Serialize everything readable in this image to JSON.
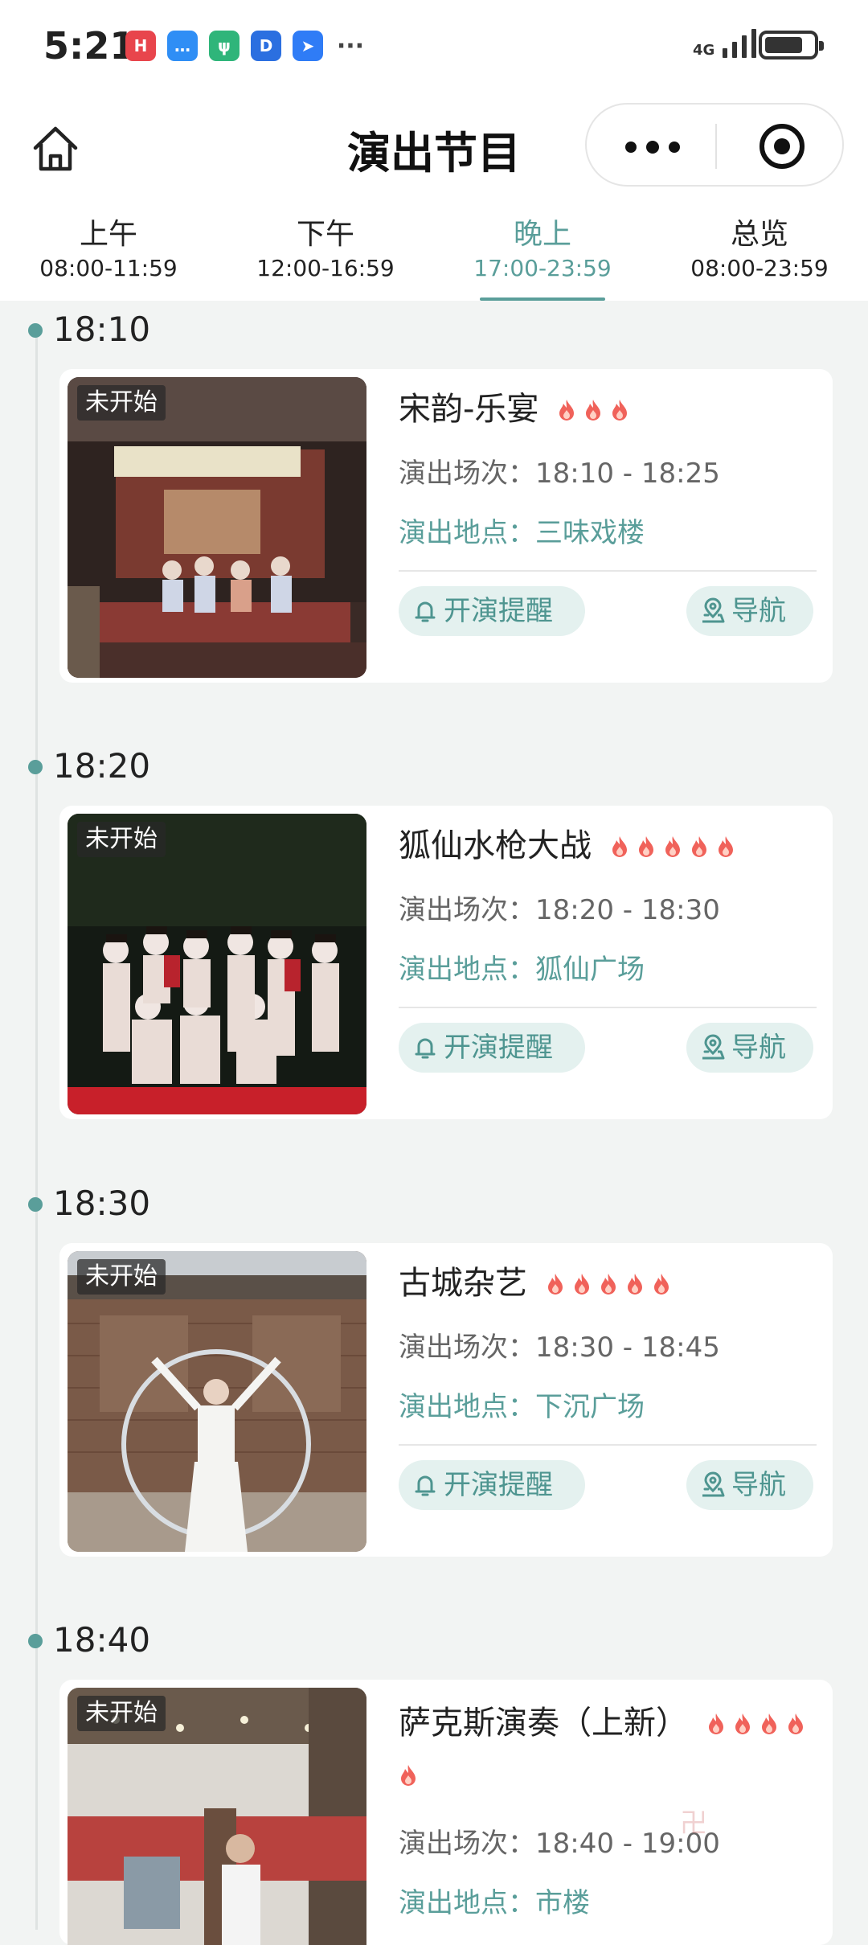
{
  "status_bar": {
    "time": "5:21",
    "network": "4G",
    "signal_bars": 4,
    "battery_percent": 80,
    "notification_icons": [
      {
        "name": "huawei-icon",
        "color": "#e8454c",
        "glyph": "H"
      },
      {
        "name": "message-icon",
        "color": "#2f8ef5",
        "glyph": "…"
      },
      {
        "name": "app-green-icon",
        "color": "#2fb57a",
        "glyph": "ψ"
      },
      {
        "name": "app-d-icon",
        "color": "#2b6fe0",
        "glyph": "D"
      },
      {
        "name": "app-feishu-icon",
        "color": "#2f7cf6",
        "glyph": "➤"
      }
    ],
    "more": "···"
  },
  "header": {
    "title": "演出节目"
  },
  "tabs": [
    {
      "label": "上午",
      "range": "08:00-11:59",
      "active": false
    },
    {
      "label": "下午",
      "range": "12:00-16:59",
      "active": false
    },
    {
      "label": "晚上",
      "range": "17:00-23:59",
      "active": true
    },
    {
      "label": "总览",
      "range": "08:00-23:59",
      "active": false
    }
  ],
  "labels": {
    "session_prefix": "演出场次：",
    "place_prefix": "演出地点：",
    "remind_button": "开演提醒",
    "nav_button": "导航"
  },
  "shows": [
    {
      "time": "18:10",
      "status": "未开始",
      "name": "宋韵-乐宴",
      "heat": 3,
      "session": "18:10 - 18:25",
      "place": "三味戏楼",
      "image": "stage-performance"
    },
    {
      "time": "18:20",
      "status": "未开始",
      "name": "狐仙水枪大战",
      "heat": 5,
      "session": "18:20 - 18:30",
      "place": "狐仙广场",
      "image": "group-performance"
    },
    {
      "time": "18:30",
      "status": "未开始",
      "name": "古城杂艺",
      "heat": 5,
      "session": "18:30 - 18:45",
      "place": "下沉广场",
      "image": "hoop-performance"
    },
    {
      "time": "18:40",
      "status": "未开始",
      "name": "萨克斯演奏（上新）",
      "heat": 5,
      "session": "18:40 - 19:00",
      "place": "市楼",
      "image": "saxophone-performance"
    }
  ],
  "colors": {
    "accent": "#5a9e9a",
    "button_bg": "#e4f1ef",
    "flame": "#f0625a"
  }
}
